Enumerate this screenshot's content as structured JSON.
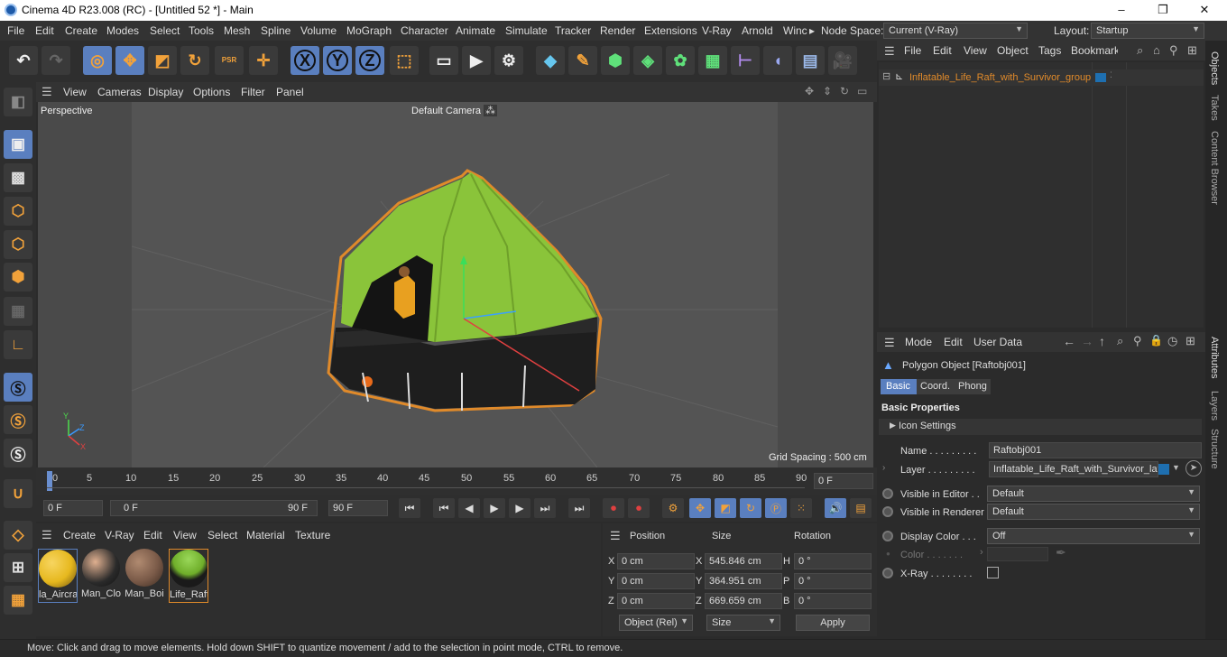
{
  "window": {
    "title": "Cinema 4D R23.008 (RC) - [Untitled 52 *] - Main",
    "minimize": "–",
    "maximize": "❐",
    "close": "✕"
  },
  "menu": {
    "items": [
      "File",
      "Edit",
      "Create",
      "Modes",
      "Select",
      "Tools",
      "Mesh",
      "Spline",
      "Volume",
      "MoGraph",
      "Character",
      "Animate",
      "Simulate",
      "Tracker",
      "Render",
      "Extensions",
      "V-Ray",
      "Arnold",
      "Winc"
    ],
    "more": "▸",
    "nodespace_label": "Node Space:",
    "nodespace_value": "Current (V-Ray)",
    "layout_label": "Layout:",
    "layout_value": "Startup"
  },
  "toolbar": {
    "x": "X",
    "y": "Y",
    "z": "Z",
    "psr": "PSR"
  },
  "viewport": {
    "menu": [
      "View",
      "Cameras",
      "Display",
      "Options",
      "Filter",
      "Panel"
    ],
    "label": "Perspective",
    "camera": "Default Camera",
    "camera_icon": "⁂",
    "grid": "Grid Spacing : 500 cm",
    "axis_y": "Y",
    "axis_z": "Z",
    "axis_x": "X"
  },
  "timeline": {
    "ticks": [
      "0",
      "5",
      "10",
      "15",
      "20",
      "25",
      "30",
      "35",
      "40",
      "45",
      "50",
      "55",
      "60",
      "65",
      "70",
      "75",
      "80",
      "85",
      "90"
    ],
    "current": "0 F"
  },
  "transport": {
    "start": "0 F",
    "range_start": "0 F",
    "range_end": "90 F",
    "end": "90 F"
  },
  "materials": {
    "menu": [
      "Create",
      "V-Ray",
      "Edit",
      "View",
      "Select",
      "Material",
      "Texture"
    ],
    "items": [
      {
        "label": "la_Aircra",
        "color": "#e6b81e"
      },
      {
        "label": "Man_Clo",
        "color": "#2a2a2a"
      },
      {
        "label": "Man_Boi",
        "color": "#7a5a48"
      },
      {
        "label": "Life_Raft",
        "color": "#6fae2a"
      }
    ]
  },
  "coords": {
    "headers": {
      "position": "Position",
      "size": "Size",
      "rotation": "Rotation"
    },
    "rows": [
      {
        "axis": "X",
        "pos": "0 cm",
        "size_axis": "X",
        "size": "545.846 cm",
        "rot_axis": "H",
        "rot": "0 °"
      },
      {
        "axis": "Y",
        "pos": "0 cm",
        "size_axis": "Y",
        "size": "364.951 cm",
        "rot_axis": "P",
        "rot": "0 °"
      },
      {
        "axis": "Z",
        "pos": "0 cm",
        "size_axis": "Z",
        "size": "669.659 cm",
        "rot_axis": "B",
        "rot": "0 °"
      }
    ],
    "mode": "Object (Rel)",
    "size_mode": "Size",
    "apply": "Apply"
  },
  "objects": {
    "menu": [
      "File",
      "Edit",
      "View",
      "Object",
      "Tags",
      "Bookmarks"
    ],
    "item": "Inflatable_Life_Raft_with_Survivor_group"
  },
  "attributes": {
    "menu": [
      "Mode",
      "Edit",
      "User Data"
    ],
    "object": "Polygon Object [Raftobj001]",
    "tabs": [
      "Basic",
      "Coord.",
      "Phong"
    ],
    "section": "Basic Properties",
    "icon_settings": "Icon Settings",
    "name_label": "Name . . . . . . . . .",
    "name_value": "Raftobj001",
    "layer_label": "Layer . . . . . . . . .",
    "layer_value": "Inflatable_Life_Raft_with_Survivor_lay",
    "vis_editor_label": "Visible in Editor . .",
    "vis_editor_value": "Default",
    "vis_render_label": "Visible in Renderer",
    "vis_render_value": "Default",
    "display_color_label": "Display Color . . .",
    "display_color_value": "Off",
    "color_label": "Color . . . . . . .",
    "xray_label": "X-Ray . . . . . . . ."
  },
  "side_tabs": [
    "Objects",
    "Takes",
    "Content Browser",
    "Attributes",
    "Layers",
    "Structure"
  ],
  "status": "Move: Click and drag to move elements. Hold down SHIFT to quantize movement / add to the selection in point mode, CTRL to remove.",
  "colors": {
    "accent": "#5a7fbf",
    "object_orange": "#e08a2a",
    "raft_green": "#8ac43a"
  }
}
